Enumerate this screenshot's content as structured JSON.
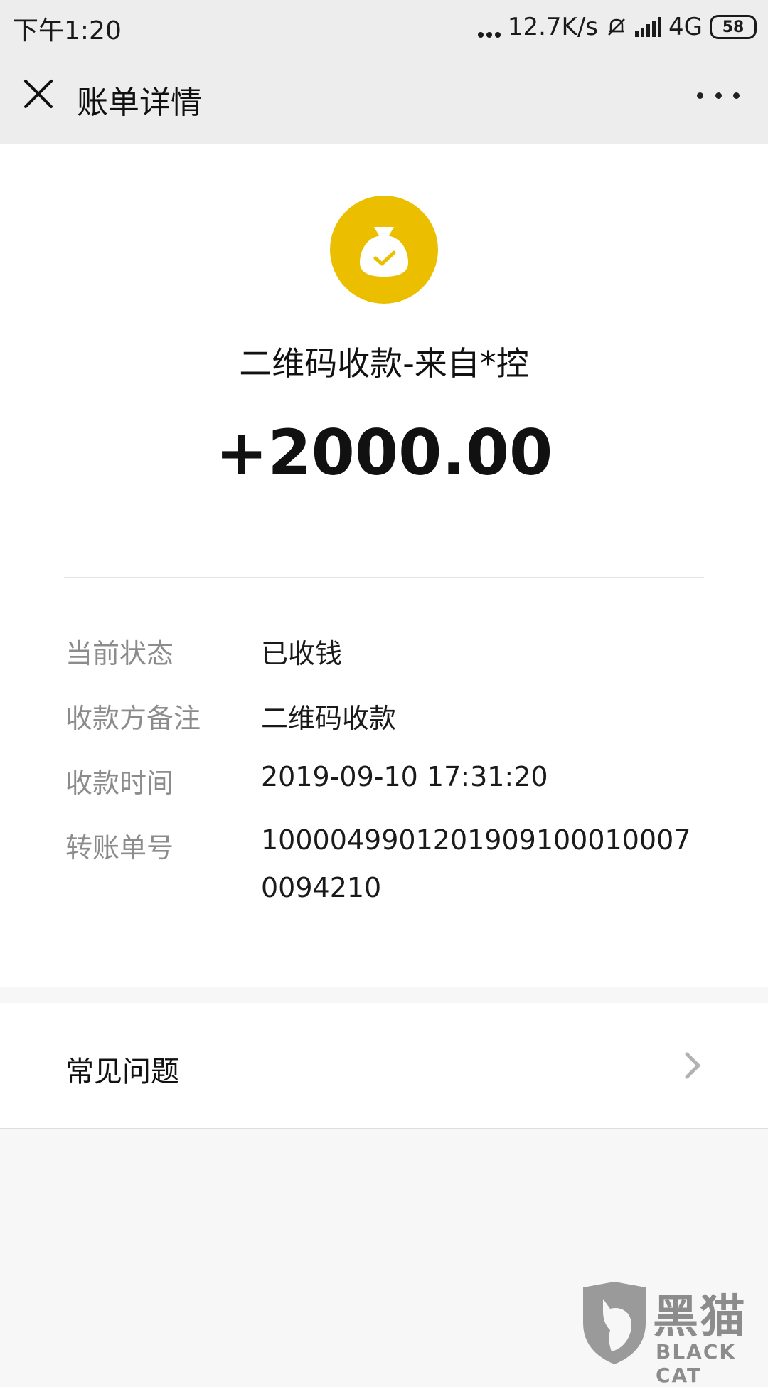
{
  "status_bar": {
    "time": "下午1:20",
    "network_speed": "12.7K/s",
    "network_type": "4G",
    "battery": "58"
  },
  "header": {
    "title": "账单详情",
    "close_icon": "close-icon",
    "more_icon": "more-horizontal-icon"
  },
  "transaction": {
    "icon": "money-bag-check-icon",
    "icon_color": "#EBBF00",
    "title": "二维码收款-来自*控",
    "amount": "+2000.00"
  },
  "details": [
    {
      "label": "当前状态",
      "value": "已收钱"
    },
    {
      "label": "收款方备注",
      "value": "二维码收款"
    },
    {
      "label": "收款时间",
      "value": "2019-09-10 17:31:20"
    },
    {
      "label": "转账单号",
      "value": "1000049901201909100010007009421 0"
    }
  ],
  "faq": {
    "label": "常见问题",
    "icon": "chevron-right-icon"
  },
  "watermark": {
    "brand_cn": "黑猫",
    "brand_en": "BLACK CAT"
  }
}
